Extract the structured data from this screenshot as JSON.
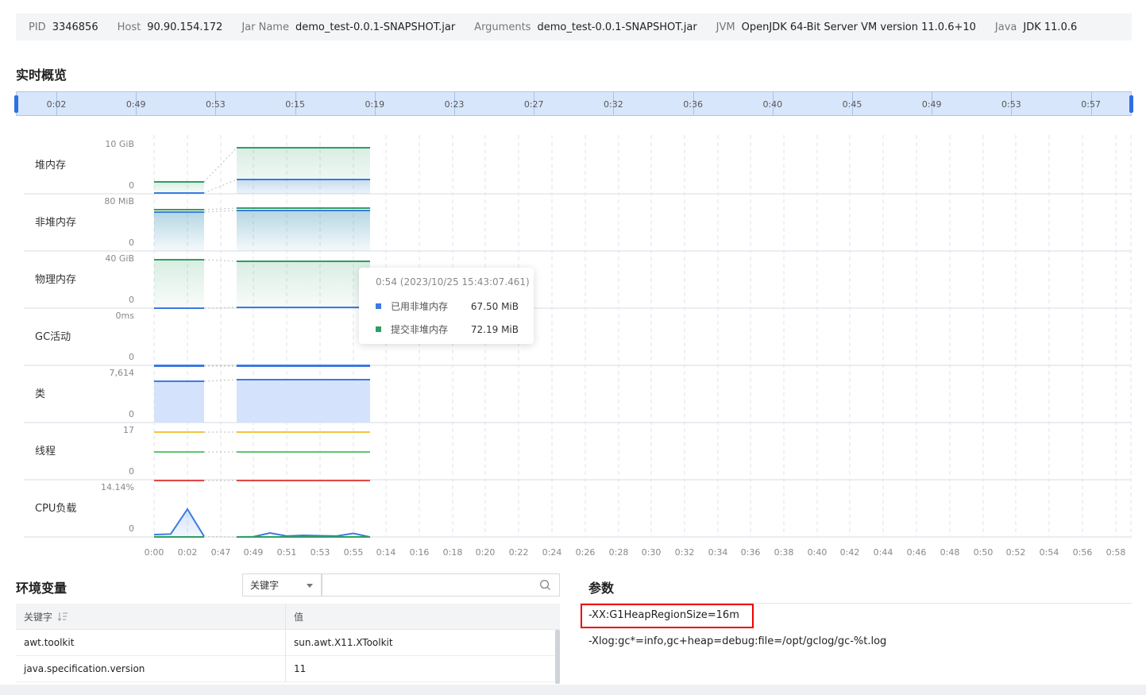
{
  "info": [
    {
      "key": "PID",
      "value": "3346856"
    },
    {
      "key": "Host",
      "value": "90.90.154.172"
    },
    {
      "key": "Jar Name",
      "value": "demo_test-0.0.1-SNAPSHOT.jar"
    },
    {
      "key": "Arguments",
      "value": "demo_test-0.0.1-SNAPSHOT.jar"
    },
    {
      "key": "JVM",
      "value": "OpenJDK 64-Bit Server VM version 11.0.6+10"
    },
    {
      "key": "Java",
      "value": "JDK 11.0.6"
    }
  ],
  "overview_title": "实时概览",
  "timeline_labels": [
    "0:02",
    "0:49",
    "0:53",
    "0:15",
    "0:19",
    "0:23",
    "0:27",
    "0:32",
    "0:36",
    "0:40",
    "0:45",
    "0:49",
    "0:53",
    "0:57"
  ],
  "rows": [
    {
      "label": "堆内存",
      "max": "10 GiB",
      "min": "0"
    },
    {
      "label": "非堆内存",
      "max": "80 MiB",
      "min": "0"
    },
    {
      "label": "物理内存",
      "max": "40 GiB",
      "min": "0"
    },
    {
      "label": "GC活动",
      "max": "0ms",
      "min": "0"
    },
    {
      "label": "类",
      "max": "7,614",
      "min": "0"
    },
    {
      "label": "线程",
      "max": "17",
      "min": "0"
    },
    {
      "label": "CPU负载",
      "max": "14.14%",
      "min": "0"
    }
  ],
  "x_labels": [
    "0:00",
    "0:02",
    "0:47",
    "0:49",
    "0:51",
    "0:53",
    "0:55",
    "0:14",
    "0:16",
    "0:18",
    "0:20",
    "0:22",
    "0:24",
    "0:26",
    "0:28",
    "0:30",
    "0:32",
    "0:34",
    "0:36",
    "0:38",
    "0:40",
    "0:42",
    "0:44",
    "0:46",
    "0:48",
    "0:50",
    "0:52",
    "0:54",
    "0:56",
    "0:58"
  ],
  "cpu_values": [
    0.9,
    1.1,
    8.5,
    0.4,
    0.2,
    0.3,
    1.4,
    0.5,
    0.7,
    0.6,
    0.5,
    1.3,
    0.2
  ],
  "tooltip": {
    "title": "0:54 (2023/10/25 15:43:07.461)",
    "items": [
      {
        "name": "已用非堆内存",
        "value": "67.50 MiB",
        "color": "#3b7be0"
      },
      {
        "name": "提交非堆内存",
        "value": "72.19 MiB",
        "color": "#2e9e62"
      }
    ]
  },
  "env": {
    "title": "环境变量",
    "select_value": "关键字",
    "search_placeholder": "",
    "col_key": "关键字",
    "col_value": "值",
    "rows": [
      {
        "key": "awt.toolkit",
        "value": "sun.awt.X11.XToolkit"
      },
      {
        "key": "java.specification.version",
        "value": "11"
      }
    ]
  },
  "params": {
    "title": "参数",
    "items": [
      "-XX:G1HeapRegionSize=16m",
      "-Xlog:gc*=info,gc+heap=debug:file=/opt/gclog/gc-%t.log"
    ]
  },
  "colors": {
    "used": "#3b7be0",
    "committed": "#2e9e62",
    "thread_yellow": "#f2c53d",
    "thread_green": "#5cc96b",
    "thread_red": "#e04848"
  }
}
